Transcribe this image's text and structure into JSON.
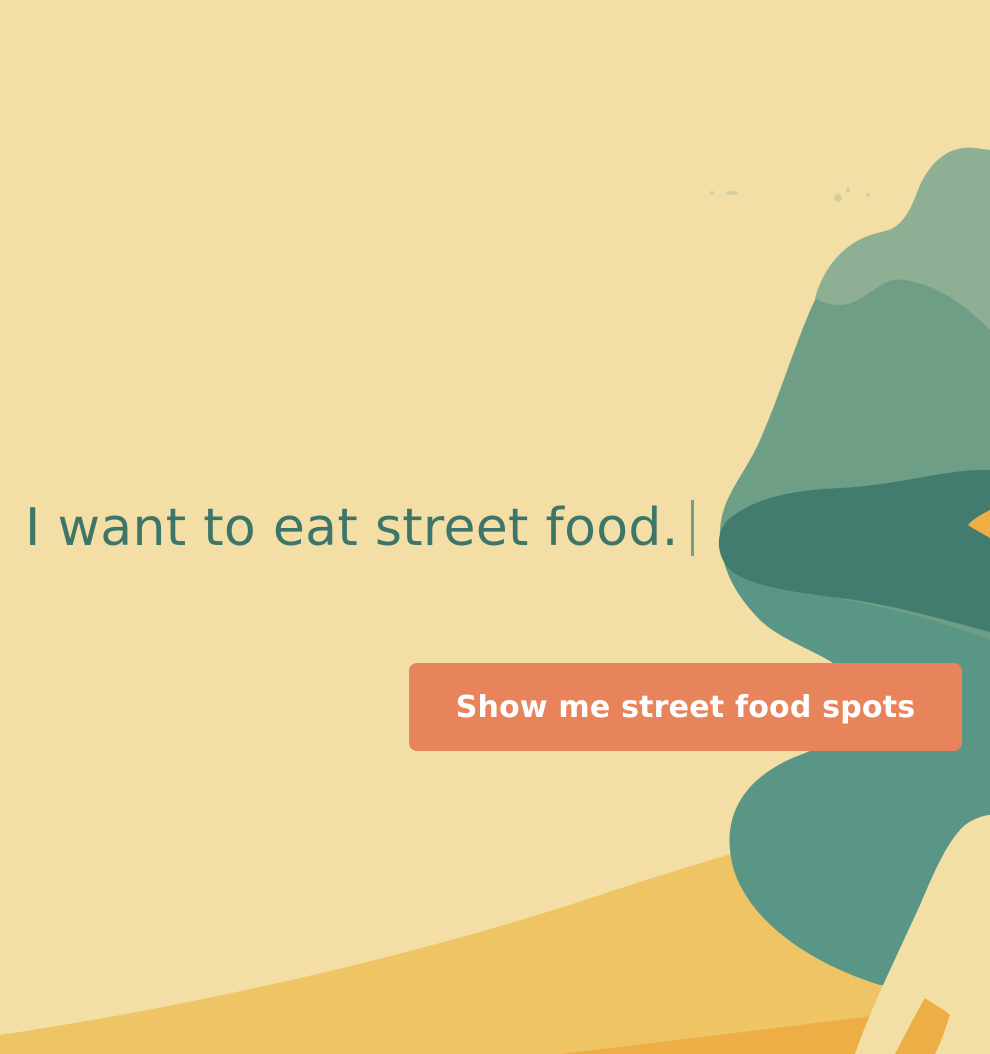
{
  "hero": {
    "headline": "I want to eat street food.",
    "cta_label": "Show me street food spots"
  },
  "colors": {
    "background": "#F3DFA6",
    "headline_text": "#3E7569",
    "caret": "#6F9E8B",
    "cta_bg": "#E8845C",
    "cta_text": "#FFFFFF",
    "sand_light": "#EEC465",
    "sand_dark": "#ECAE45",
    "foliage_light": "#8EAF93",
    "foliage_mid": "#6F9E86",
    "foliage_dark": "#427C6E",
    "foliage_teal": "#5A9685",
    "trunk": "#F3DFA6"
  },
  "illustration": {
    "name": "tree-landscape-illustration"
  }
}
